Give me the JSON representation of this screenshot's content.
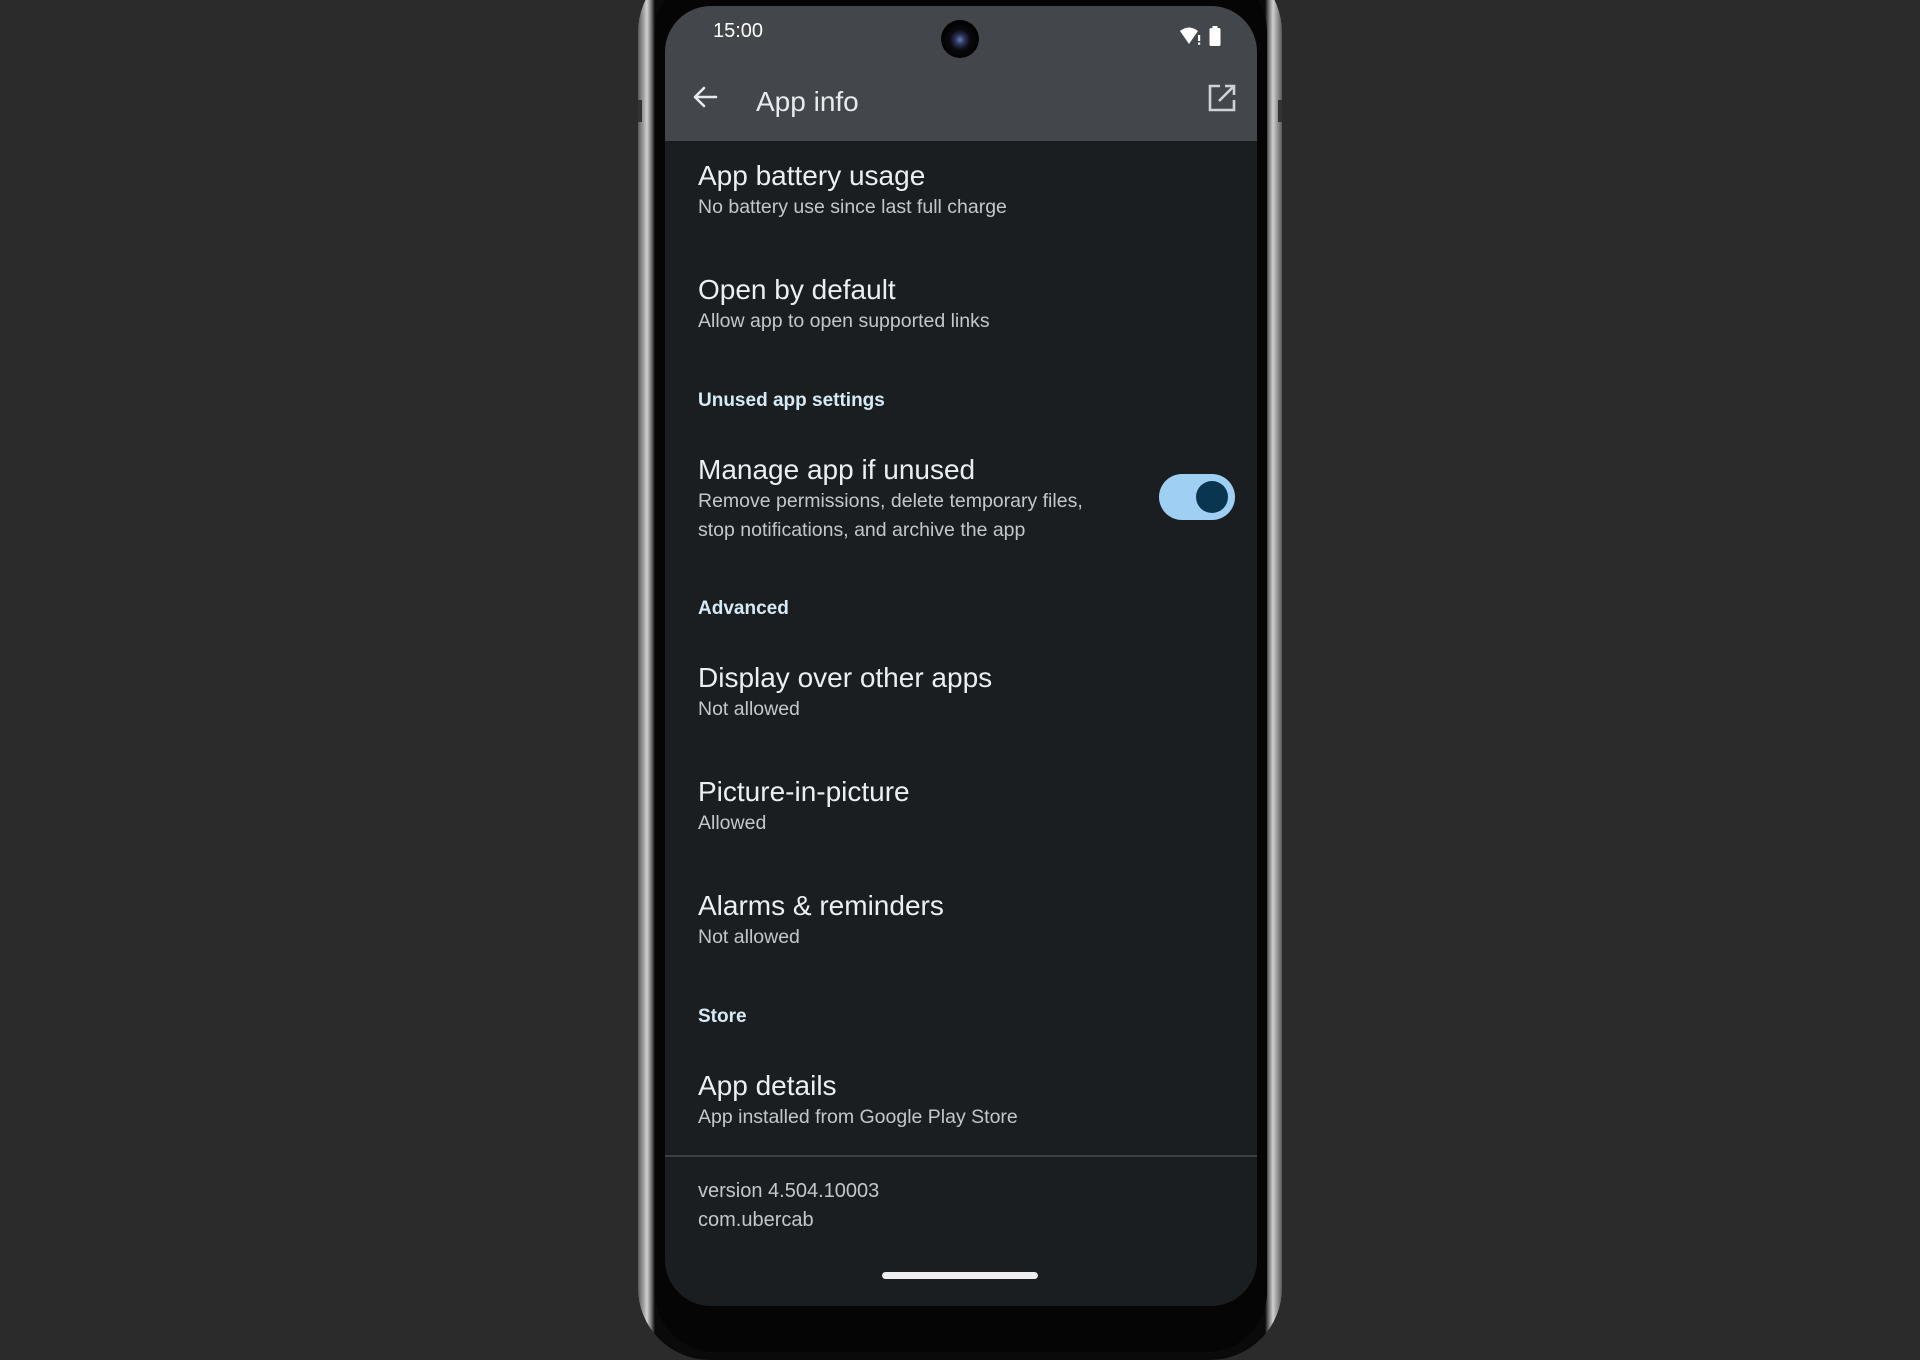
{
  "status_bar": {
    "time": "15:00",
    "icons": [
      "wifi-alert-icon",
      "battery-icon"
    ]
  },
  "app_bar": {
    "back_icon": "arrow-back-icon",
    "title": "App info",
    "open_icon": "open-in-new-icon"
  },
  "items": [
    {
      "title": "App battery usage",
      "subtitle": "No battery use since last full charge"
    },
    {
      "title": "Open by default",
      "subtitle": "Allow app to open supported links"
    }
  ],
  "sections": {
    "unused": {
      "header": "Unused app settings",
      "manage": {
        "title": "Manage app if unused",
        "subtitle_line1": "Remove permissions, delete temporary files,",
        "subtitle_line2": "stop notifications, and archive the app",
        "toggle_on": true
      }
    },
    "advanced": {
      "header": "Advanced",
      "items": [
        {
          "title": "Display over other apps",
          "subtitle": "Not allowed"
        },
        {
          "title": "Picture-in-picture",
          "subtitle": "Allowed"
        },
        {
          "title": "Alarms & reminders",
          "subtitle": "Not allowed"
        }
      ]
    },
    "store": {
      "header": "Store",
      "items": [
        {
          "title": "App details",
          "subtitle": "App installed from Google Play Store"
        }
      ]
    }
  },
  "footer": {
    "version": "version 4.504.10003",
    "package": "com.ubercab"
  },
  "colors": {
    "accent_track": "#9fd0f3",
    "accent_thumb": "#0a3550",
    "section_header": "#d6eaf5",
    "background": "#1b1e21",
    "app_bar": "#43464a"
  }
}
